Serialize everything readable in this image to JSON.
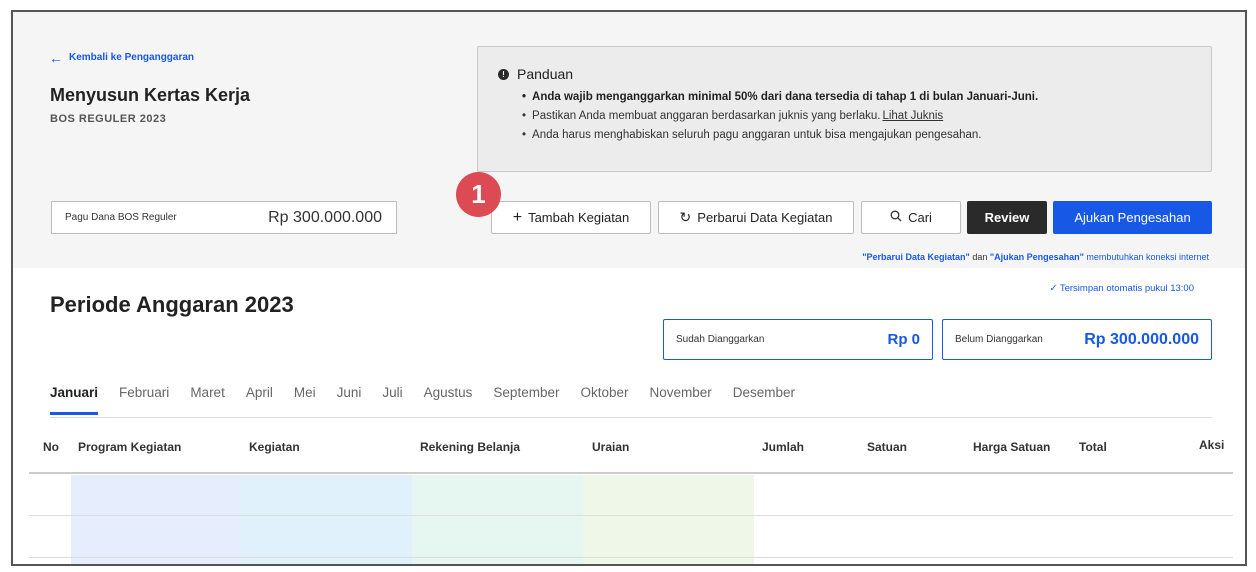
{
  "header": {
    "back_link": "Kembali ke Penganggaran",
    "title": "Menyusun Kertas Kerja",
    "subtitle": "BOS REGULER 2023"
  },
  "guide": {
    "title": "Panduan",
    "items": [
      "Anda wajib menganggarkan minimal 50% dari dana tersedia di tahap 1 di bulan Januari-Juni.",
      "Pastikan Anda membuat anggaran berdasarkan juknis yang berlaku.",
      "Anda harus menghabiskan seluruh pagu anggaran untuk bisa mengajukan pengesahan."
    ],
    "link_label": "Lihat Juknis"
  },
  "pagu": {
    "label": "Pagu Dana BOS Reguler",
    "value": "Rp 300.000.000"
  },
  "toolbar": {
    "tambah": "Tambah Kegiatan",
    "perbarui": "Perbarui Data Kegiatan",
    "cari": "Cari",
    "review": "Review",
    "ajukan": "Ajukan Pengesahan"
  },
  "step_badge": "1",
  "note": {
    "part1": "\"Perbarui Data Kegiatan\"",
    "mid": " dan ",
    "part2": "\"Ajukan Pengesahan\"",
    "end": " membutuhkan koneksi internet"
  },
  "saved_status": "✓ Tersimpan otomatis pukul 13:00",
  "periode_title": "Periode Anggaran 2023",
  "summary": {
    "sudah_label": "Sudah Dianggarkan",
    "sudah_value": "Rp 0",
    "belum_label": "Belum Dianggarkan",
    "belum_value": "Rp 300.000.000"
  },
  "months": [
    "Januari",
    "Februari",
    "Maret",
    "April",
    "Mei",
    "Juni",
    "Juli",
    "Agustus",
    "September",
    "Oktober",
    "November",
    "Desember"
  ],
  "active_month": "Januari",
  "table": {
    "columns": [
      "No",
      "Program Kegiatan",
      "Kegiatan",
      "Rekening Belanja",
      "Uraian",
      "Jumlah",
      "Satuan",
      "Harga Satuan",
      "Total",
      "Aksi"
    ]
  },
  "colors": {
    "primary": "#1758e6",
    "badge": "#dc4a54",
    "dark_button": "#2a2a2a",
    "col_program": "#e6edfd",
    "col_kegiatan": "#e1f1fb",
    "col_rekening": "#e6f7f1",
    "col_uraian": "#eff8e8"
  }
}
